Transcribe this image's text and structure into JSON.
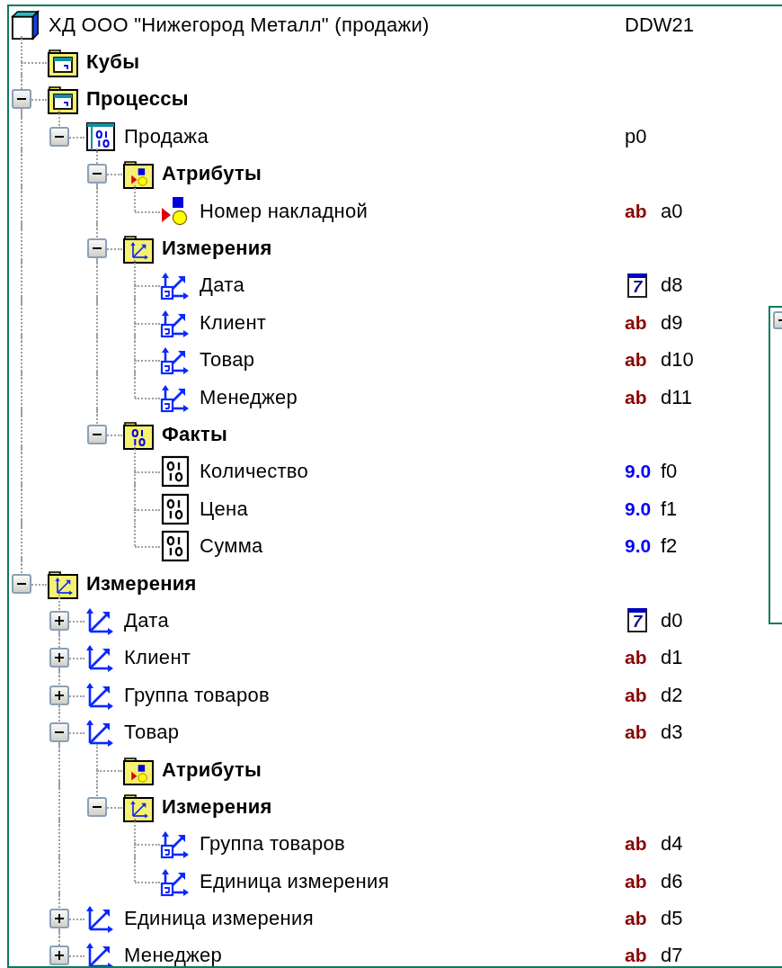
{
  "tree": {
    "label": "ХД ООО \"Нижегород Металл\" (продажи)",
    "kind": "root",
    "code": "DDW21",
    "children": [
      {
        "label": "Кубы",
        "kind": "cube_folder"
      },
      {
        "label": "Процессы",
        "kind": "cube_folder",
        "expanded": true,
        "children": [
          {
            "label": "Продажа",
            "kind": "process",
            "expanded": true,
            "code": "p0",
            "children": [
              {
                "label": "Атрибуты",
                "kind": "attr_folder",
                "expanded": true,
                "children": [
                  {
                    "label": "Номер накладной",
                    "kind": "attribute",
                    "type": {
                      "kind": "string",
                      "text": "ab"
                    },
                    "code": "a0"
                  }
                ]
              },
              {
                "label": "Измерения",
                "kind": "dim_folder",
                "expanded": true,
                "children": [
                  {
                    "label": "Дата",
                    "kind": "dim_link",
                    "type": {
                      "kind": "date",
                      "text": "7"
                    },
                    "code": "d8"
                  },
                  {
                    "label": "Клиент",
                    "kind": "dim_link",
                    "type": {
                      "kind": "string",
                      "text": "ab"
                    },
                    "code": "d9"
                  },
                  {
                    "label": "Товар",
                    "kind": "dim_link",
                    "type": {
                      "kind": "string",
                      "text": "ab"
                    },
                    "code": "d10"
                  },
                  {
                    "label": "Менеджер",
                    "kind": "dim_link",
                    "type": {
                      "kind": "string",
                      "text": "ab"
                    },
                    "code": "d11"
                  }
                ]
              },
              {
                "label": "Факты",
                "kind": "fact_folder",
                "expanded": true,
                "children": [
                  {
                    "label": "Количество",
                    "kind": "fact",
                    "type": {
                      "kind": "number",
                      "text": "9.0"
                    },
                    "code": "f0"
                  },
                  {
                    "label": "Цена",
                    "kind": "fact",
                    "type": {
                      "kind": "number",
                      "text": "9.0"
                    },
                    "code": "f1"
                  },
                  {
                    "label": "Сумма",
                    "kind": "fact",
                    "type": {
                      "kind": "number",
                      "text": "9.0"
                    },
                    "code": "f2"
                  }
                ]
              }
            ]
          }
        ]
      },
      {
        "label": "Измерения",
        "kind": "dim_folder",
        "expanded": true,
        "children": [
          {
            "label": "Дата",
            "kind": "dimension",
            "expanded": false,
            "type": {
              "kind": "date",
              "text": "7"
            },
            "code": "d0"
          },
          {
            "label": "Клиент",
            "kind": "dimension",
            "expanded": false,
            "type": {
              "kind": "string",
              "text": "ab"
            },
            "code": "d1"
          },
          {
            "label": "Группа товаров",
            "kind": "dimension",
            "expanded": false,
            "type": {
              "kind": "string",
              "text": "ab"
            },
            "code": "d2"
          },
          {
            "label": "Товар",
            "kind": "dimension",
            "expanded": true,
            "type": {
              "kind": "string",
              "text": "ab"
            },
            "code": "d3",
            "children": [
              {
                "label": "Атрибуты",
                "kind": "attr_folder"
              },
              {
                "label": "Измерения",
                "kind": "dim_folder",
                "expanded": true,
                "children": [
                  {
                    "label": "Группа товаров",
                    "kind": "dim_link",
                    "type": {
                      "kind": "string",
                      "text": "ab"
                    },
                    "code": "d4"
                  },
                  {
                    "label": "Единица измерения",
                    "kind": "dim_link",
                    "type": {
                      "kind": "string",
                      "text": "ab"
                    },
                    "code": "d6"
                  }
                ]
              }
            ]
          },
          {
            "label": "Единица измерения",
            "kind": "dimension",
            "expanded": false,
            "type": {
              "kind": "string",
              "text": "ab"
            },
            "code": "d5"
          },
          {
            "label": "Менеджер",
            "kind": "dimension",
            "expanded": false,
            "type": {
              "kind": "string",
              "text": "ab"
            },
            "code": "d7"
          }
        ]
      }
    ]
  }
}
